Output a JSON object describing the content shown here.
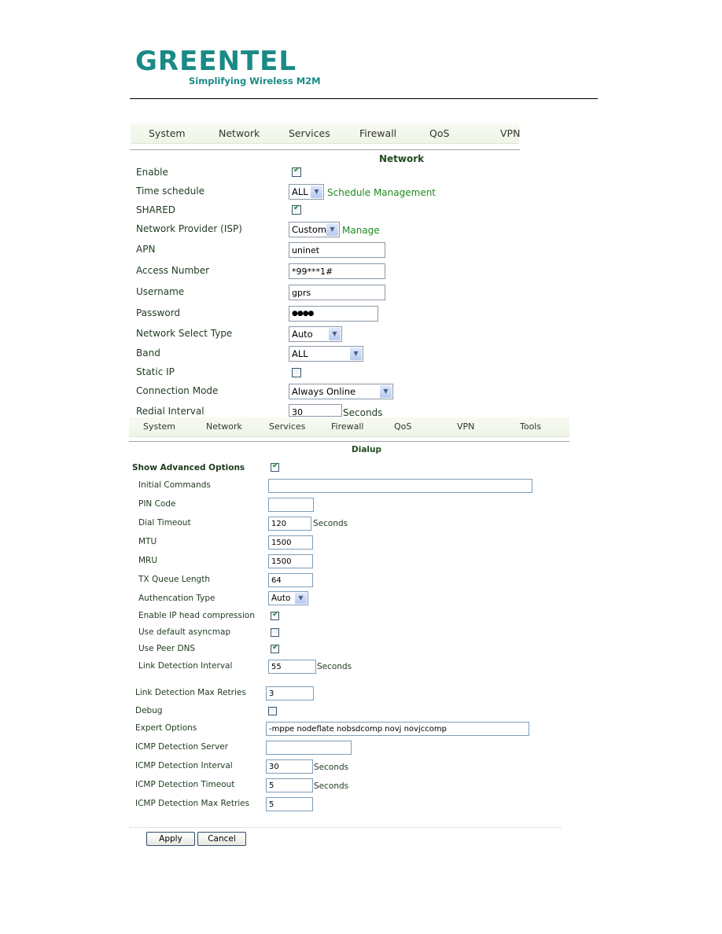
{
  "brand": {
    "name": "GREENTEL",
    "tagline": "Simplifying Wireless M2M",
    "color": "#1a8a86"
  },
  "colors": {
    "link": "#1f8a1f",
    "section_title": "#1d4a1d",
    "nav_bg": "#eef5e6"
  },
  "nav_top": {
    "items": [
      "System",
      "Network",
      "Services",
      "Firewall",
      "QoS",
      "VPN"
    ]
  },
  "network": {
    "title": "Network",
    "enable": {
      "label": "Enable",
      "checked": true
    },
    "time_schedule": {
      "label": "Time schedule",
      "value": "ALL",
      "link": "Schedule Management"
    },
    "shared": {
      "label": "SHARED",
      "checked": true
    },
    "isp": {
      "label": "Network Provider (ISP)",
      "value": "Custom",
      "link": "Manage"
    },
    "apn": {
      "label": "APN",
      "value": "uninet"
    },
    "access_number": {
      "label": "Access Number",
      "value": "*99***1#"
    },
    "username": {
      "label": "Username",
      "value": "gprs"
    },
    "password": {
      "label": "Password",
      "value": "●●●●"
    },
    "network_select_type": {
      "label": "Network Select Type",
      "value": "Auto"
    },
    "band": {
      "label": "Band",
      "value": "ALL"
    },
    "static_ip": {
      "label": "Static IP",
      "checked": false
    },
    "connection_mode": {
      "label": "Connection Mode",
      "value": "Always Online"
    },
    "redial_interval": {
      "label": "Redial Interval",
      "value": "30",
      "unit": "Seconds"
    }
  },
  "nav_bottom": {
    "items": [
      "System",
      "Network",
      "Services",
      "Firewall",
      "QoS",
      "VPN",
      "Tools"
    ]
  },
  "dialup": {
    "title": "Dialup",
    "show_advanced": {
      "label": "Show Advanced Options",
      "checked": true
    },
    "initial_commands": {
      "label": "Initial Commands",
      "value": ""
    },
    "pin_code": {
      "label": "PIN Code",
      "value": ""
    },
    "dial_timeout": {
      "label": "Dial Timeout",
      "value": "120",
      "unit": "Seconds"
    },
    "mtu": {
      "label": "MTU",
      "value": "1500"
    },
    "mru": {
      "label": "MRU",
      "value": "1500"
    },
    "tx_queue_length": {
      "label": "TX Queue Length",
      "value": "64"
    },
    "auth_type": {
      "label": "Authencation Type",
      "value": "Auto"
    },
    "ip_head_compression": {
      "label": "Enable IP head compression",
      "checked": true
    },
    "default_asyncmap": {
      "label": "Use default asyncmap",
      "checked": false
    },
    "peer_dns": {
      "label": "Use Peer DNS",
      "checked": true
    },
    "link_detection_interval": {
      "label": "Link Detection Interval",
      "value": "55",
      "unit": "Seconds"
    },
    "link_detection_max_retries": {
      "label": "Link Detection Max Retries",
      "value": "3"
    },
    "debug": {
      "label": "Debug",
      "checked": false
    },
    "expert_options": {
      "label": "Expert Options",
      "value": "-mppe nodeflate nobsdcomp novj novjccomp"
    },
    "icmp_server": {
      "label": "ICMP Detection Server",
      "value": ""
    },
    "icmp_interval": {
      "label": "ICMP Detection Interval",
      "value": "30",
      "unit": "Seconds"
    },
    "icmp_timeout": {
      "label": "ICMP Detection Timeout",
      "value": "5",
      "unit": "Seconds"
    },
    "icmp_max_retries": {
      "label": "ICMP Detection Max Retries",
      "value": "5"
    }
  },
  "buttons": {
    "apply": "Apply",
    "cancel": "Cancel"
  }
}
